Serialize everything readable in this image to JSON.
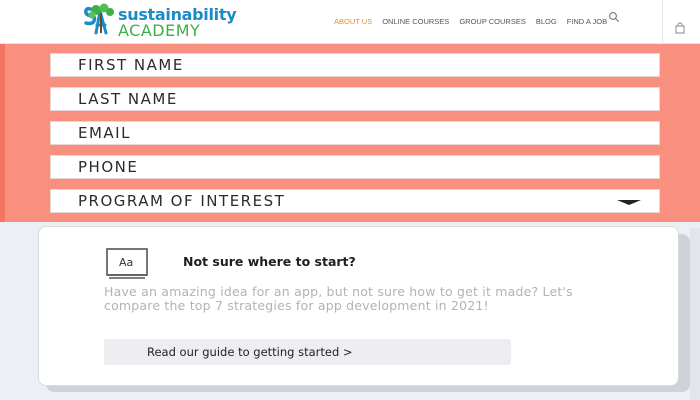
{
  "header": {
    "logo": {
      "line1": "sustainability",
      "line2": "ACADEMY",
      "mark_text": "SA",
      "icon": "tree-logo-icon"
    },
    "nav": [
      {
        "label": "ABOUT US",
        "active": true
      },
      {
        "label": "ONLINE COURSES",
        "active": false
      },
      {
        "label": "GROUP COURSES",
        "active": false
      },
      {
        "label": "BLOG",
        "active": false
      },
      {
        "label": "FIND A JOB",
        "active": false
      }
    ],
    "search_icon": "search-icon",
    "cart_icon": "shopping-bag-icon"
  },
  "form": {
    "fields": [
      {
        "placeholder": "FIRST NAME"
      },
      {
        "placeholder": "LAST NAME"
      },
      {
        "placeholder": "EMAIL"
      },
      {
        "placeholder": "PHONE"
      },
      {
        "placeholder": "PROGRAM OF INTEREST",
        "type": "select"
      }
    ]
  },
  "card": {
    "icon": "book-icon",
    "icon_text": "Aa",
    "title": "Not sure where to start?",
    "body": "Have an amazing idea for an app, but not sure how to get it made? Let's compare the top 7 strategies for app development in 2021!",
    "button_label": "Read our guide to getting started >"
  },
  "colors": {
    "accent_orange": "#e58f2a",
    "form_band": "#f98f7e",
    "logo_blue": "#1a8bc7",
    "logo_green": "#3fae49"
  }
}
